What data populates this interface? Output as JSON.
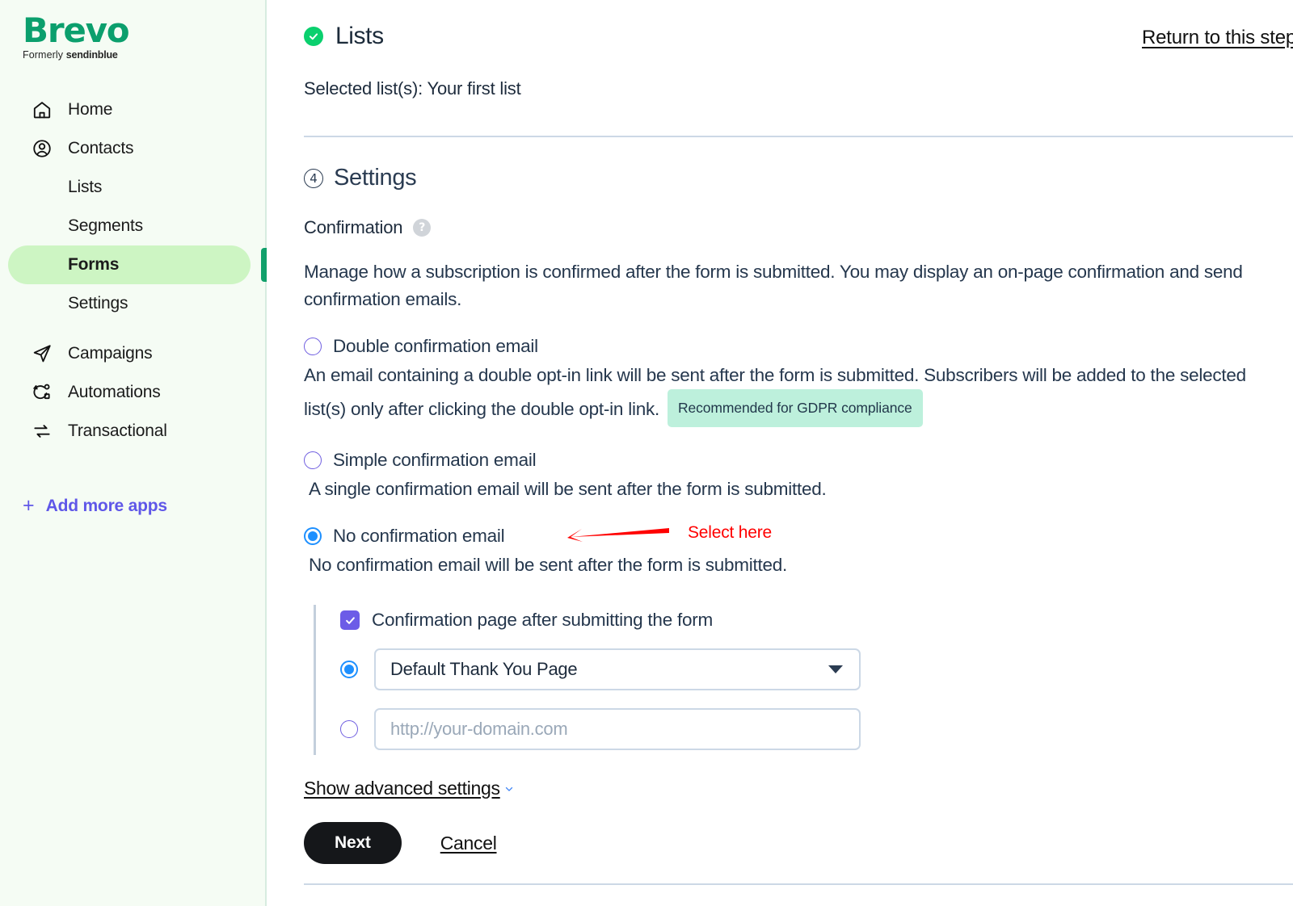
{
  "sidebar": {
    "logo": {
      "name": "Brevo",
      "tagline_prefix": "Formerly ",
      "tagline_brand": "sendinblue"
    },
    "items": [
      {
        "label": "Home",
        "icon": "home-icon"
      },
      {
        "label": "Contacts",
        "icon": "user-circle-icon"
      }
    ],
    "sub_items": [
      {
        "label": "Lists",
        "active": false
      },
      {
        "label": "Segments",
        "active": false
      },
      {
        "label": "Forms",
        "active": true
      },
      {
        "label": "Settings",
        "active": false
      }
    ],
    "items2": [
      {
        "label": "Campaigns",
        "icon": "paper-plane-icon"
      },
      {
        "label": "Automations",
        "icon": "automation-icon"
      },
      {
        "label": "Transactional",
        "icon": "exchange-arrows-icon"
      }
    ],
    "add_apps": {
      "label": "Add more apps",
      "plus": "+"
    },
    "accent_green": "#11a06b",
    "active_pill_bg": "#cdf5c3",
    "add_apps_color": "#5f57e8"
  },
  "header": {
    "step_title": "Lists",
    "check_icon": "check-circle-icon",
    "return_link": "Return to this step",
    "selected_lists": "Selected list(s): Your first list"
  },
  "settings": {
    "step_number": "4",
    "title": "Settings",
    "confirmation_label": "Confirmation",
    "help_icon": "question-mark-icon",
    "description": "Manage how a subscription is confirmed after the form is submitted. You may display an on-page confirmation and send confirmation emails.",
    "options": [
      {
        "label": "Double confirmation email",
        "desc": " An email containing a double opt-in link will be sent after the form is submitted. Subscribers will be added to the selected list(s) only after clicking the double opt-in link.",
        "badge": "Recommended for GDPR compliance",
        "selected": false
      },
      {
        "label": "Simple confirmation email",
        "desc": "A single confirmation email will be sent after the form is submitted.",
        "badge": null,
        "selected": false
      },
      {
        "label": "No confirmation email",
        "desc": "No confirmation email will be sent after the form is submitted.",
        "badge": null,
        "selected": true
      }
    ],
    "confirmation_page": {
      "checkbox_label": "Confirmation page after submitting the form",
      "checkbox_checked": true,
      "option_default": {
        "label": "Default Thank You Page",
        "selected": true
      },
      "option_url": {
        "placeholder": "http://your-domain.com",
        "value": "",
        "selected": false
      }
    },
    "advanced_link": "Show advanced settings",
    "buttons": {
      "next": "Next",
      "cancel": "Cancel"
    }
  },
  "annotation": {
    "text": "Select here",
    "color": "#ff0000",
    "arrow_direction": "left"
  }
}
